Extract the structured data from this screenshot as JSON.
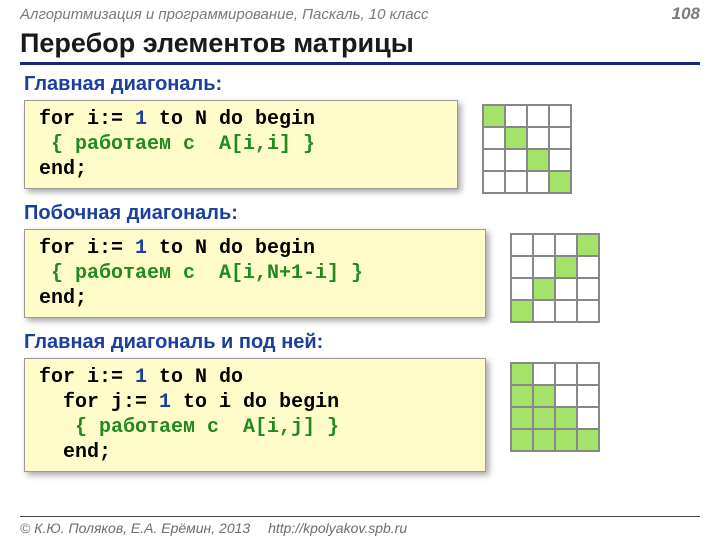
{
  "header": {
    "course": "Алгоритмизация и программирование, Паскаль, 10 класс",
    "page": "108"
  },
  "title": "Перебор элементов матрицы",
  "sections": [
    {
      "label": "Главная диагональ:",
      "code": {
        "l1a": "for i:= ",
        "l1b": "1",
        "l1c": " to N do begin",
        "l2": " { работаем с  A[i,i] }",
        "l3": "end;"
      },
      "grid": [
        [
          1,
          0,
          0,
          0
        ],
        [
          0,
          1,
          0,
          0
        ],
        [
          0,
          0,
          1,
          0
        ],
        [
          0,
          0,
          0,
          1
        ]
      ]
    },
    {
      "label": "Побочная диагональ:",
      "code": {
        "l1a": "for i:= ",
        "l1b": "1",
        "l1c": " to N do begin",
        "l2": " { работаем с  A[i,N+1-i] }",
        "l3": "end;"
      },
      "grid": [
        [
          0,
          0,
          0,
          1
        ],
        [
          0,
          0,
          1,
          0
        ],
        [
          0,
          1,
          0,
          0
        ],
        [
          1,
          0,
          0,
          0
        ]
      ]
    },
    {
      "label": "Главная диагональ и под ней:",
      "code": {
        "l1a": "for i:= ",
        "l1b": "1",
        "l1c": " to N do",
        "l2a": "  for j:= ",
        "l2b": "1",
        "l2c": " to i do begin",
        "l3": "   { работаем с  A[i,j] }",
        "l4": "  end;"
      },
      "grid": [
        [
          1,
          0,
          0,
          0
        ],
        [
          1,
          1,
          0,
          0
        ],
        [
          1,
          1,
          1,
          0
        ],
        [
          1,
          1,
          1,
          1
        ]
      ]
    }
  ],
  "footer": {
    "copyright": "© К.Ю. Поляков, Е.А. Ерёмин, 2013",
    "link": "http://kpolyakov.spb.ru"
  }
}
